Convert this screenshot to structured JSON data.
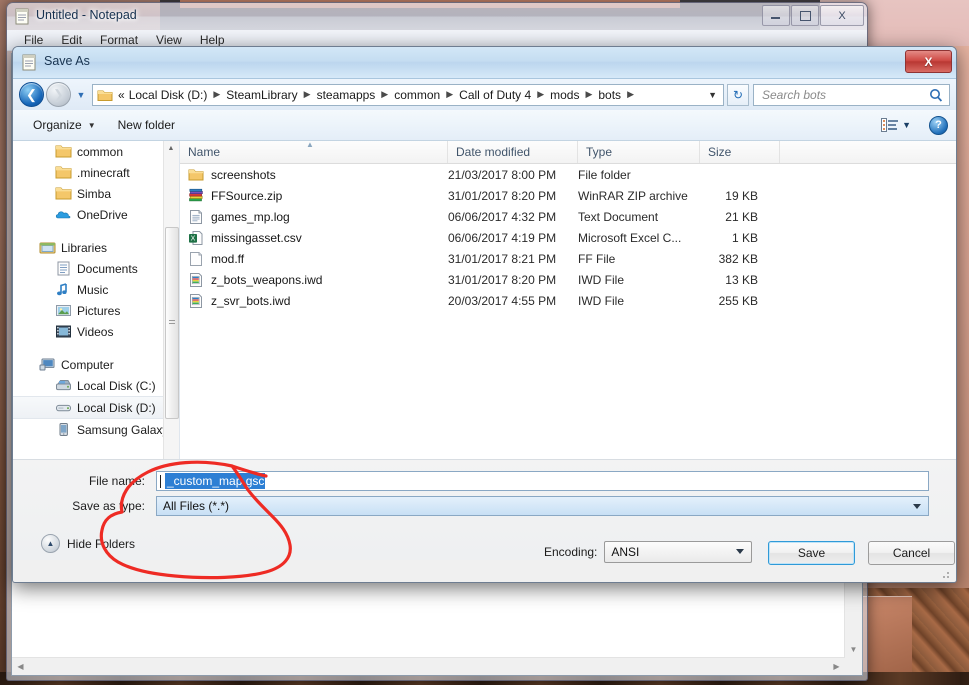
{
  "desktop": {
    "wallpaper_note": ""
  },
  "notepad": {
    "title": "Untitled - Notepad",
    "icon": "notepad-icon",
    "menu": [
      "File",
      "Edit",
      "Format",
      "View",
      "Help"
    ],
    "window_buttons": {
      "minimize": "minimize-icon",
      "maximize": "maximize-icon",
      "close": "X"
    }
  },
  "dialog": {
    "title": "Save As",
    "icon": "notepad-icon",
    "close_label": "X",
    "nav": {
      "back_icon": "back-arrow-icon",
      "forward_icon": "forward-arrow-icon",
      "history_caret": "chevron-down-icon",
      "breadcrumb_folder_icon": "folder-icon",
      "breadcrumb_prefix": "«",
      "breadcrumbs": [
        "Local Disk (D:)",
        "SteamLibrary",
        "steamapps",
        "common",
        "Call of Duty 4",
        "mods",
        "bots"
      ],
      "refresh_icon": "refresh-icon",
      "search_placeholder": "Search bots",
      "search_value": "",
      "search_icon": "magnifier-icon"
    },
    "toolbar": {
      "organize": "Organize",
      "new_folder": "New folder",
      "view_icon": "view-list-icon",
      "view_caret": "chevron-down-icon",
      "help_icon": "help-icon"
    },
    "nav_pane": {
      "items": [
        {
          "label": "common",
          "icon": "folder-icon",
          "level": 1,
          "selected": false
        },
        {
          "label": ".minecraft",
          "icon": "folder-icon",
          "level": 1,
          "selected": false
        },
        {
          "label": "Simba",
          "icon": "folder-icon",
          "level": 1,
          "selected": false
        },
        {
          "label": "OneDrive",
          "icon": "onedrive-cloud-icon",
          "level": 1,
          "selected": false
        },
        {
          "label": "Libraries",
          "icon": "libraries-icon",
          "level": 0,
          "selected": false
        },
        {
          "label": "Documents",
          "icon": "documents-icon",
          "level": 1,
          "selected": false
        },
        {
          "label": "Music",
          "icon": "music-note-icon",
          "level": 1,
          "selected": false
        },
        {
          "label": "Pictures",
          "icon": "pictures-icon",
          "level": 1,
          "selected": false
        },
        {
          "label": "Videos",
          "icon": "videos-film-icon",
          "level": 1,
          "selected": false
        },
        {
          "label": "Computer",
          "icon": "computer-icon",
          "level": 0,
          "selected": false
        },
        {
          "label": "Local Disk (C:)",
          "icon": "hard-disk-icon",
          "level": 1,
          "selected": false
        },
        {
          "label": "Local Disk (D:)",
          "icon": "drive-icon",
          "level": 1,
          "selected": true
        },
        {
          "label": "Samsung Galaxy",
          "icon": "phone-icon",
          "level": 1,
          "selected": false
        }
      ]
    },
    "file_list": {
      "columns": [
        "Name",
        "Date modified",
        "Type",
        "Size"
      ],
      "sort_arrow": "sort-ascending-icon",
      "rows": [
        {
          "name": "screenshots",
          "icon": "folder-icon",
          "date": "21/03/2017 8:00 PM",
          "type": "File folder",
          "size": ""
        },
        {
          "name": "FFSource.zip",
          "icon": "winrar-zip-icon",
          "date": "31/01/2017 8:20 PM",
          "type": "WinRAR ZIP archive",
          "size": "19 KB"
        },
        {
          "name": "games_mp.log",
          "icon": "text-file-icon",
          "date": "06/06/2017 4:32 PM",
          "type": "Text Document",
          "size": "21 KB"
        },
        {
          "name": "missingasset.csv",
          "icon": "excel-csv-icon",
          "date": "06/06/2017 4:19 PM",
          "type": "Microsoft Excel C...",
          "size": "1 KB"
        },
        {
          "name": "mod.ff",
          "icon": "blank-file-icon",
          "date": "31/01/2017 8:21 PM",
          "type": "FF File",
          "size": "382 KB"
        },
        {
          "name": "z_bots_weapons.iwd",
          "icon": "iwd-file-icon",
          "date": "31/01/2017 8:20 PM",
          "type": "IWD File",
          "size": "13 KB"
        },
        {
          "name": "z_svr_bots.iwd",
          "icon": "iwd-file-icon",
          "date": "20/03/2017 4:55 PM",
          "type": "IWD File",
          "size": "255 KB"
        }
      ]
    },
    "form": {
      "file_name_label": "File name:",
      "file_name_value": "_custom_map.gsc",
      "save_as_type_label": "Save as type:",
      "save_as_type_value": "All Files  (*.*)",
      "hide_folders_label": "Hide Folders",
      "hide_folders_icon": "chevron-up-circle-icon",
      "encoding_label": "Encoding:",
      "encoding_value": "ANSI",
      "save_label": "Save",
      "cancel_label": "Cancel"
    }
  },
  "annotation": {
    "type": "hand-drawn-circle",
    "color": "#ee2b24",
    "target": "file-name-and-save-as-type-fields"
  }
}
